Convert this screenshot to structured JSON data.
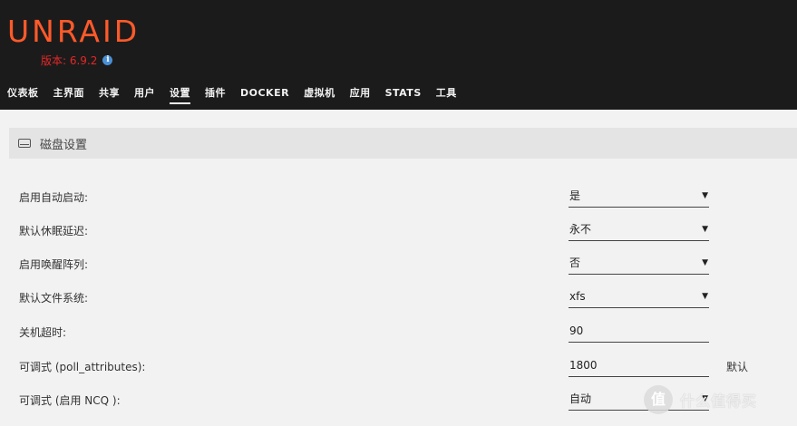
{
  "header": {
    "logo": "UNRAID",
    "version": "版本: 6.9.2",
    "nav": [
      {
        "label": "仪表板",
        "active": false
      },
      {
        "label": "主界面",
        "active": false
      },
      {
        "label": "共享",
        "active": false
      },
      {
        "label": "用户",
        "active": false
      },
      {
        "label": "设置",
        "active": true
      },
      {
        "label": "插件",
        "active": false
      },
      {
        "label": "DOCKER",
        "active": false
      },
      {
        "label": "虚拟机",
        "active": false
      },
      {
        "label": "应用",
        "active": false
      },
      {
        "label": "STATS",
        "active": false
      },
      {
        "label": "工具",
        "active": false
      }
    ]
  },
  "section": {
    "title": "磁盘设置",
    "icon": "disk-icon"
  },
  "settings": [
    {
      "label": "启用自动启动:",
      "value": "是",
      "type": "select"
    },
    {
      "label": "默认休眠延迟:",
      "value": "永不",
      "type": "select"
    },
    {
      "label": "启用唤醒阵列:",
      "value": "否",
      "type": "select"
    },
    {
      "label": "默认文件系统:",
      "value": "xfs",
      "type": "select"
    },
    {
      "label": "关机超时:",
      "value": "90",
      "type": "input"
    },
    {
      "label": "可调式 (poll_attributes):",
      "value": "1800",
      "type": "input",
      "suffix": "默认"
    },
    {
      "label": "可调式 (启用 NCQ ):",
      "value": "自动",
      "type": "select"
    }
  ],
  "watermark": {
    "icon_text": "值",
    "text": "什么值得买"
  },
  "colors": {
    "header_bg": "#1c1b1b",
    "logo": "#ff5a2a",
    "version": "#e22828",
    "body_bg": "#f2f2f2"
  }
}
